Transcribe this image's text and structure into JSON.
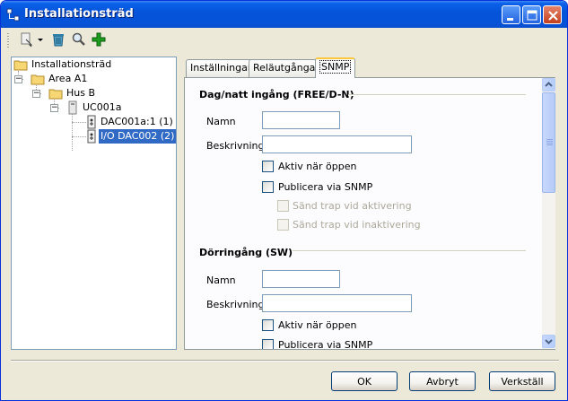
{
  "window": {
    "title": "Installationsträd"
  },
  "toolbar": {
    "icons": [
      "add-device-icon",
      "dropdown-arrow-icon",
      "recycle-bin-icon",
      "magnifier-icon",
      "green-plus-icon"
    ]
  },
  "tree": {
    "root": "Installationsträd",
    "area": "Area A1",
    "building": "Hus B",
    "controller": "UC001a",
    "device1": "DAC001a:1 (1)",
    "device2": "I/O DAC002 (2)"
  },
  "tabs": [
    "Inställningar",
    "Reläutgångar",
    "SNMP"
  ],
  "section1": {
    "title": "Dag/natt ingång (FREE/D-N)",
    "name_label": "Namn",
    "name_value": "",
    "desc_label": "Beskrivning",
    "desc_value": "",
    "active_open": "Aktiv när öppen",
    "publish_snmp": "Publicera via SNMP",
    "trap_activation": "Sänd trap vid aktivering",
    "trap_deactivation": "Sänd trap vid inaktivering"
  },
  "section2": {
    "title": "Dörringång (SW)",
    "name_label": "Namn",
    "name_value": "",
    "desc_label": "Beskrivning",
    "desc_value": "",
    "active_open": "Aktiv när öppen",
    "publish_snmp": "Publicera via SNMP"
  },
  "buttons": {
    "ok": "OK",
    "cancel": "Avbryt",
    "apply": "Verkställ"
  },
  "colors": {
    "titlebar": "#0453D9",
    "selection": "#316AC5",
    "window_bg": "#ECE9D8",
    "active_tab_accent": "#FFC83C"
  }
}
